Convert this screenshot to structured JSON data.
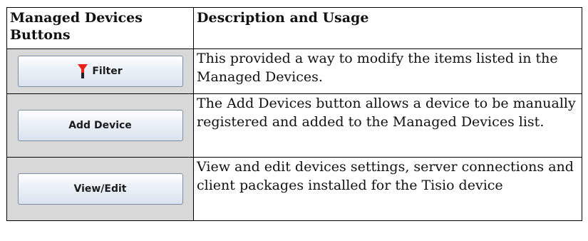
{
  "table": {
    "headers": {
      "buttons": "Managed Devices Buttons",
      "description": "Description and Usage"
    },
    "rows": [
      {
        "button_label": "Filter",
        "button_icon": "filter-funnel-icon",
        "description": "This provided a way to modify the items listed in the Managed Devices."
      },
      {
        "button_label": "Add Device",
        "description": "The Add Devices button allows a device to be manually registered and added to the Managed Devices list."
      },
      {
        "button_label": "View/Edit",
        "description": "View and edit devices settings, server connections and client packages installed for the Tisio device"
      }
    ]
  },
  "colors": {
    "cell_gray": "#d8d8d8",
    "filter_icon_red": "#e8211b",
    "button_border": "#7d8ea3"
  }
}
